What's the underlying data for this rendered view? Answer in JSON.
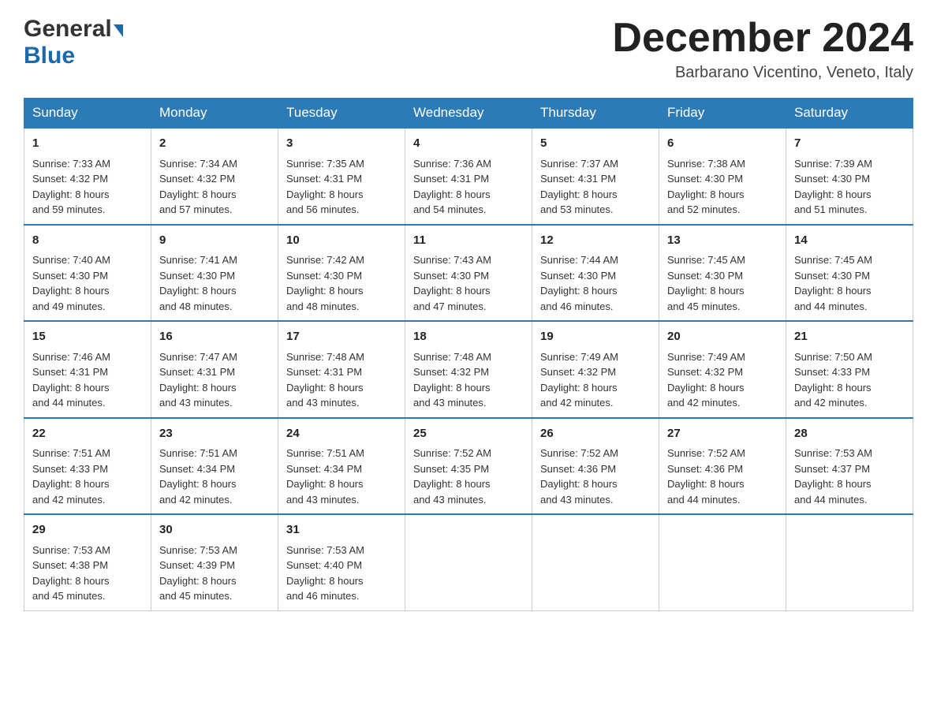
{
  "header": {
    "logo_general": "General",
    "logo_blue": "Blue",
    "month_title": "December 2024",
    "location": "Barbarano Vicentino, Veneto, Italy"
  },
  "days_of_week": [
    "Sunday",
    "Monday",
    "Tuesday",
    "Wednesday",
    "Thursday",
    "Friday",
    "Saturday"
  ],
  "weeks": [
    [
      {
        "day": "1",
        "sunrise": "7:33 AM",
        "sunset": "4:32 PM",
        "daylight": "8 hours and 59 minutes."
      },
      {
        "day": "2",
        "sunrise": "7:34 AM",
        "sunset": "4:32 PM",
        "daylight": "8 hours and 57 minutes."
      },
      {
        "day": "3",
        "sunrise": "7:35 AM",
        "sunset": "4:31 PM",
        "daylight": "8 hours and 56 minutes."
      },
      {
        "day": "4",
        "sunrise": "7:36 AM",
        "sunset": "4:31 PM",
        "daylight": "8 hours and 54 minutes."
      },
      {
        "day": "5",
        "sunrise": "7:37 AM",
        "sunset": "4:31 PM",
        "daylight": "8 hours and 53 minutes."
      },
      {
        "day": "6",
        "sunrise": "7:38 AM",
        "sunset": "4:30 PM",
        "daylight": "8 hours and 52 minutes."
      },
      {
        "day": "7",
        "sunrise": "7:39 AM",
        "sunset": "4:30 PM",
        "daylight": "8 hours and 51 minutes."
      }
    ],
    [
      {
        "day": "8",
        "sunrise": "7:40 AM",
        "sunset": "4:30 PM",
        "daylight": "8 hours and 49 minutes."
      },
      {
        "day": "9",
        "sunrise": "7:41 AM",
        "sunset": "4:30 PM",
        "daylight": "8 hours and 48 minutes."
      },
      {
        "day": "10",
        "sunrise": "7:42 AM",
        "sunset": "4:30 PM",
        "daylight": "8 hours and 48 minutes."
      },
      {
        "day": "11",
        "sunrise": "7:43 AM",
        "sunset": "4:30 PM",
        "daylight": "8 hours and 47 minutes."
      },
      {
        "day": "12",
        "sunrise": "7:44 AM",
        "sunset": "4:30 PM",
        "daylight": "8 hours and 46 minutes."
      },
      {
        "day": "13",
        "sunrise": "7:45 AM",
        "sunset": "4:30 PM",
        "daylight": "8 hours and 45 minutes."
      },
      {
        "day": "14",
        "sunrise": "7:45 AM",
        "sunset": "4:30 PM",
        "daylight": "8 hours and 44 minutes."
      }
    ],
    [
      {
        "day": "15",
        "sunrise": "7:46 AM",
        "sunset": "4:31 PM",
        "daylight": "8 hours and 44 minutes."
      },
      {
        "day": "16",
        "sunrise": "7:47 AM",
        "sunset": "4:31 PM",
        "daylight": "8 hours and 43 minutes."
      },
      {
        "day": "17",
        "sunrise": "7:48 AM",
        "sunset": "4:31 PM",
        "daylight": "8 hours and 43 minutes."
      },
      {
        "day": "18",
        "sunrise": "7:48 AM",
        "sunset": "4:32 PM",
        "daylight": "8 hours and 43 minutes."
      },
      {
        "day": "19",
        "sunrise": "7:49 AM",
        "sunset": "4:32 PM",
        "daylight": "8 hours and 42 minutes."
      },
      {
        "day": "20",
        "sunrise": "7:49 AM",
        "sunset": "4:32 PM",
        "daylight": "8 hours and 42 minutes."
      },
      {
        "day": "21",
        "sunrise": "7:50 AM",
        "sunset": "4:33 PM",
        "daylight": "8 hours and 42 minutes."
      }
    ],
    [
      {
        "day": "22",
        "sunrise": "7:51 AM",
        "sunset": "4:33 PM",
        "daylight": "8 hours and 42 minutes."
      },
      {
        "day": "23",
        "sunrise": "7:51 AM",
        "sunset": "4:34 PM",
        "daylight": "8 hours and 42 minutes."
      },
      {
        "day": "24",
        "sunrise": "7:51 AM",
        "sunset": "4:34 PM",
        "daylight": "8 hours and 43 minutes."
      },
      {
        "day": "25",
        "sunrise": "7:52 AM",
        "sunset": "4:35 PM",
        "daylight": "8 hours and 43 minutes."
      },
      {
        "day": "26",
        "sunrise": "7:52 AM",
        "sunset": "4:36 PM",
        "daylight": "8 hours and 43 minutes."
      },
      {
        "day": "27",
        "sunrise": "7:52 AM",
        "sunset": "4:36 PM",
        "daylight": "8 hours and 44 minutes."
      },
      {
        "day": "28",
        "sunrise": "7:53 AM",
        "sunset": "4:37 PM",
        "daylight": "8 hours and 44 minutes."
      }
    ],
    [
      {
        "day": "29",
        "sunrise": "7:53 AM",
        "sunset": "4:38 PM",
        "daylight": "8 hours and 45 minutes."
      },
      {
        "day": "30",
        "sunrise": "7:53 AM",
        "sunset": "4:39 PM",
        "daylight": "8 hours and 45 minutes."
      },
      {
        "day": "31",
        "sunrise": "7:53 AM",
        "sunset": "4:40 PM",
        "daylight": "8 hours and 46 minutes."
      },
      null,
      null,
      null,
      null
    ]
  ],
  "labels": {
    "sunrise": "Sunrise:",
    "sunset": "Sunset:",
    "daylight": "Daylight:"
  }
}
